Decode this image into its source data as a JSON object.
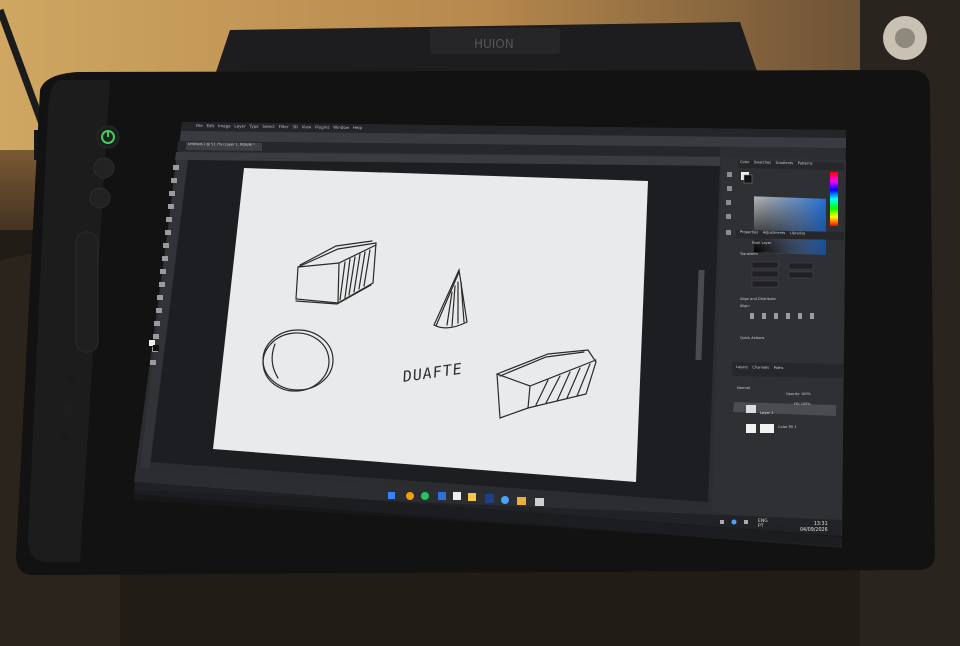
{
  "device": {
    "brand_mark": "HUION"
  },
  "app": {
    "menu": [
      "File",
      "Edit",
      "Image",
      "Layer",
      "Type",
      "Select",
      "Filter",
      "3D",
      "View",
      "Plugins",
      "Window",
      "Help"
    ],
    "document_tab": "Untitled-1 @ 51.7% (Layer 1, RGB/8) *",
    "canvas_word": "DUAFTE",
    "panels": {
      "color_tabs": [
        "Color",
        "Swatches",
        "Gradients",
        "Patterns"
      ],
      "properties_tabs": [
        "Properties",
        "Adjustments",
        "Libraries"
      ],
      "pixel_layer": "Pixel Layer",
      "transform": "Transform",
      "align": "Align and Distribute",
      "align_sub": "Align:",
      "quick_actions": "Quick Actions",
      "layers_tabs": [
        "Layers",
        "Channels",
        "Paths"
      ],
      "blend_mode": "Normal",
      "opacity": "Opacity: 100%",
      "fill": "Fill: 100%",
      "layers": [
        "Layer 1",
        "Color Fill 1"
      ]
    }
  },
  "taskbar": {
    "lang_top": "ENG",
    "lang_bottom": "PT",
    "time": "13:31",
    "date": "04/09/2026"
  },
  "colors": {
    "wall": "#c9a25f",
    "bezel": "#141414",
    "ps_ui": "#2c2d31",
    "canvas": "#e7e9ea",
    "power_led": "#3ccf5b"
  }
}
